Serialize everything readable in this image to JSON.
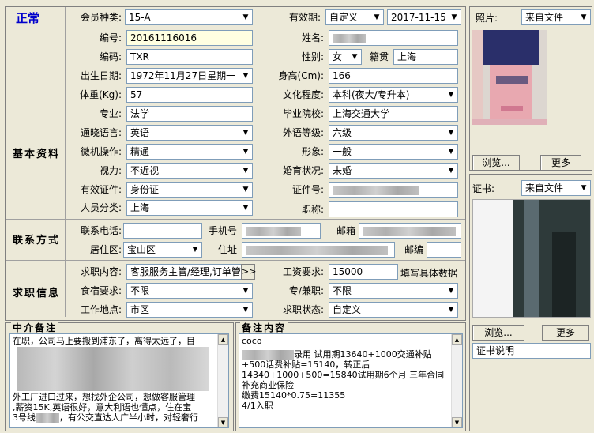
{
  "header": {
    "status": "正常",
    "member_type_label": "会员种类:",
    "member_type_value": "15-A",
    "validity_label": "有效期:",
    "validity_mode": "自定义",
    "validity_date": "2017-11-15"
  },
  "basic": {
    "section_title": "基本资料",
    "id_label": "编号:",
    "id_value": "20161116016",
    "name_label": "姓名:",
    "code_label": "编码:",
    "code_value": "TXR",
    "gender_label": "性别:",
    "gender_value": "女",
    "native_label": "籍贯",
    "native_value": "上海",
    "birth_label": "出生日期:",
    "birth_value": "1972年11月27日星期一",
    "height_label": "身高(Cm):",
    "height_value": "166",
    "weight_label": "体重(Kg):",
    "weight_value": "57",
    "edu_label": "文化程度:",
    "edu_value": "本科(夜大/专升本)",
    "major_label": "专业:",
    "major_value": "法学",
    "school_label": "毕业院校:",
    "school_value": "上海交通大学",
    "lang_label": "通晓语言:",
    "lang_value": "英语",
    "lang_level_label": "外语等级:",
    "lang_level_value": "六级",
    "computer_label": "微机操作:",
    "computer_value": "精通",
    "image_label": "形象:",
    "image_value": "一般",
    "vision_label": "视力:",
    "vision_value": "不近视",
    "marriage_label": "婚育状况:",
    "marriage_value": "未婚",
    "cert_type_label": "有效证件:",
    "cert_type_value": "身份证",
    "cert_no_label": "证件号:",
    "person_type_label": "人员分类:",
    "person_type_value": "上海",
    "title_label": "职称:"
  },
  "contact": {
    "section_title": "联系方式",
    "phone_label": "联系电话:",
    "mobile_label": "手机号",
    "email_label": "邮箱",
    "district_label": "居住区:",
    "district_value": "宝山区",
    "address_label": "住址",
    "zip_label": "邮编"
  },
  "job": {
    "section_title": "求职信息",
    "content_label": "求职内容:",
    "content_value": "客服服务主管/经理,订单管",
    "more_btn": ">>",
    "salary_label": "工资要求:",
    "salary_value": "15000",
    "salary_hint": "填写具体数据",
    "board_label": "食宿要求:",
    "board_value": "不限",
    "parttime_label": "专/兼职:",
    "parttime_value": "不限",
    "location_label": "工作地点:",
    "location_value": "市区",
    "state_label": "求职状态:",
    "state_value": "自定义"
  },
  "agency_notes": {
    "title": "中介备注",
    "line1": "在职，公司马上要搬到浦东了，离得太远了，目",
    "line2": "外工厂进口过来，想找外企公司，想做客服管理",
    "line3": ",薪资15K,英语很好，意大利语也懂点，住在宝",
    "line4a": "3号线",
    "line4b": "，有公交直达人广半小时，对轻奢行"
  },
  "remarks": {
    "title": "备注内容",
    "line1": "coco",
    "line2a": "",
    "line2b": "录用  试用期13640+1000交通补贴",
    "line3": "+500话费补贴=15140，转正后",
    "line4": "14340+1000+500=15840试用期6个月 三年合同",
    "line5": "补充商业保险",
    "line6": "缴费15140*0.75=11355",
    "line7": "4/1入职"
  },
  "photo": {
    "label": "照片:",
    "source": "来自文件",
    "browse_btn": "浏览...",
    "more_btn": "更多"
  },
  "certificate": {
    "label": "证书:",
    "source": "来自文件",
    "browse_btn": "浏览...",
    "more_btn": "更多",
    "desc": "证书说明"
  },
  "colors": {
    "status_blue": "#0000cc",
    "field_border": "#7f9db9",
    "window_bg": "#ece9d8",
    "highlight_input": "#ffffe1"
  }
}
